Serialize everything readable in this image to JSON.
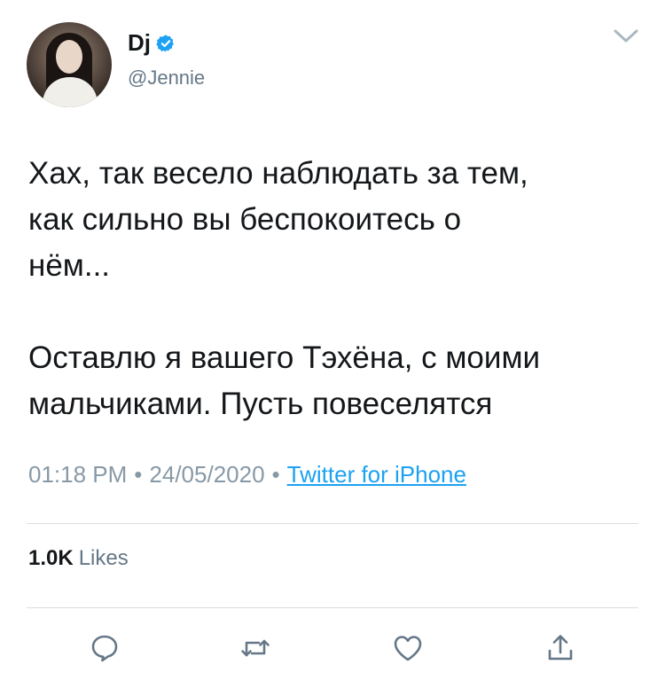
{
  "user": {
    "display_name": "Dj",
    "handle": "@Jennie",
    "verified": true
  },
  "tweet": {
    "text": "Хах, так весело наблюдать за тем,\nкак сильно вы беспокоитесь о\nнём...\n\nОставлю я вашего Тэхёна, с моими\nмальчиками. Пусть повеселятся"
  },
  "meta": {
    "time": "01:18 PM",
    "separator": "•",
    "date": "24/05/2020",
    "source": "Twitter for iPhone"
  },
  "stats": {
    "likes_count": "1.0K",
    "likes_label": "Likes"
  },
  "icons": {
    "reply": "reply-icon",
    "retweet": "retweet-icon",
    "like": "heart-icon",
    "share": "share-icon",
    "menu": "chevron-down-icon",
    "verified": "verified-badge-icon"
  },
  "colors": {
    "accent": "#1da1f2",
    "secondary_text": "#657786",
    "icon_gray": "#657786"
  }
}
